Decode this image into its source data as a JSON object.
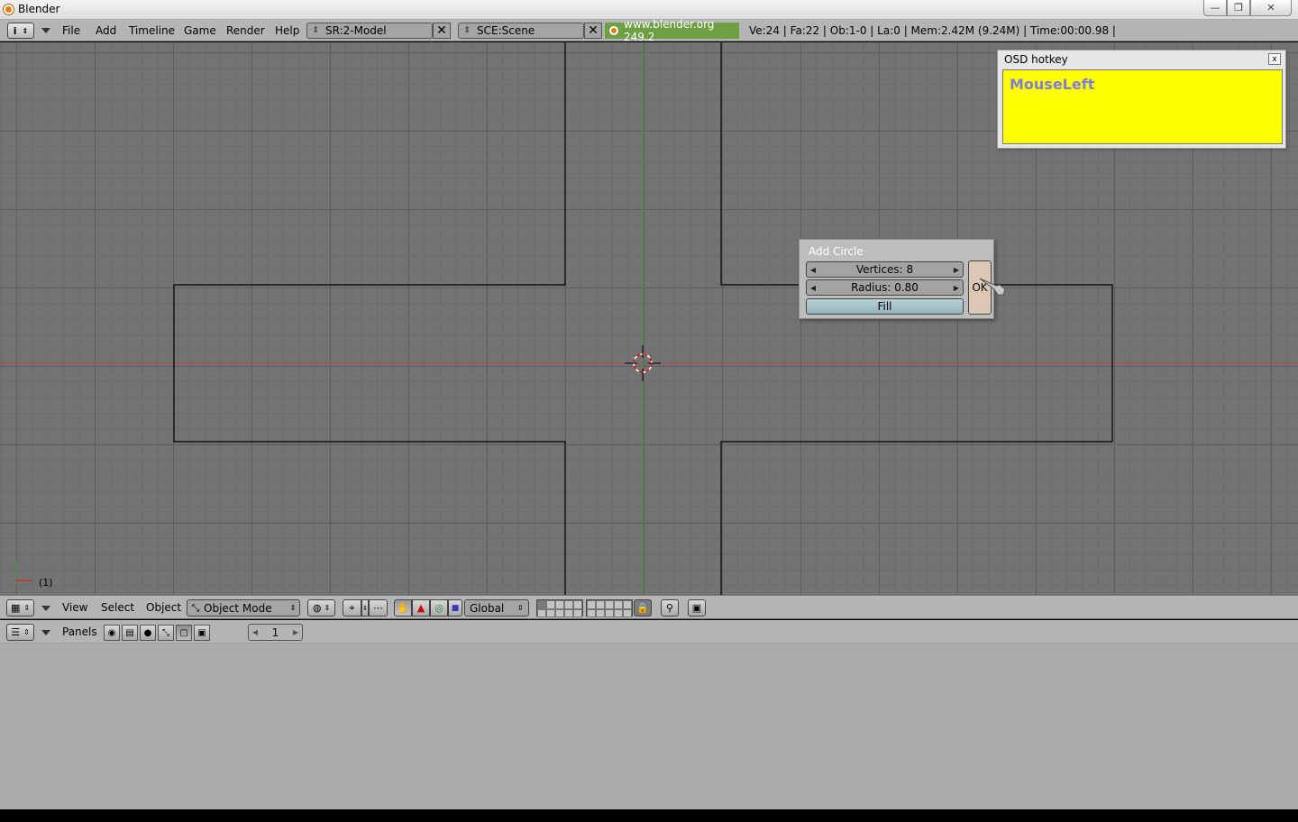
{
  "window": {
    "title": "Blender",
    "minimize": "—",
    "maximize": "❐",
    "close": "✕"
  },
  "infobar": {
    "info_icon": "i",
    "menus": [
      "File",
      "Add",
      "Timeline",
      "Game",
      "Render",
      "Help"
    ],
    "screen_field": "SR:2-Model",
    "scene_field": "SCE:Scene",
    "clear_mark": "✕",
    "site": "www.blender.org 249.2",
    "stats": "Ve:24 | Fa:22 | Ob:1-0 | La:0  | Mem:2.42M (9.24M)  | Time:00:00.98 |"
  },
  "viewport": {
    "frame_label": "(1)",
    "colors": {
      "background": "#737373",
      "x_axis": "#b44a3a",
      "y_axis": "#3c9c3c",
      "edges": "#000000"
    }
  },
  "popup": {
    "title": "Add Circle",
    "vertices": "Vertices: 8",
    "radius": "Radius: 0.80",
    "fill": "Fill",
    "ok": "OK"
  },
  "osd": {
    "title": "OSD hotkey",
    "close": "x",
    "hotkey": "MouseLeft"
  },
  "view_header": {
    "menus": [
      "View",
      "Select",
      "Object"
    ],
    "mode": "Object Mode",
    "orientation": "Global",
    "icons": [
      "grid-icon",
      "pivot-icon",
      "manipulator-hand-icon",
      "translate-icon",
      "rotate-icon",
      "scale-icon",
      "lock-icon",
      "snap-icon",
      "render-icon"
    ]
  },
  "buttons_header": {
    "label": "Panels",
    "frame": "1"
  }
}
